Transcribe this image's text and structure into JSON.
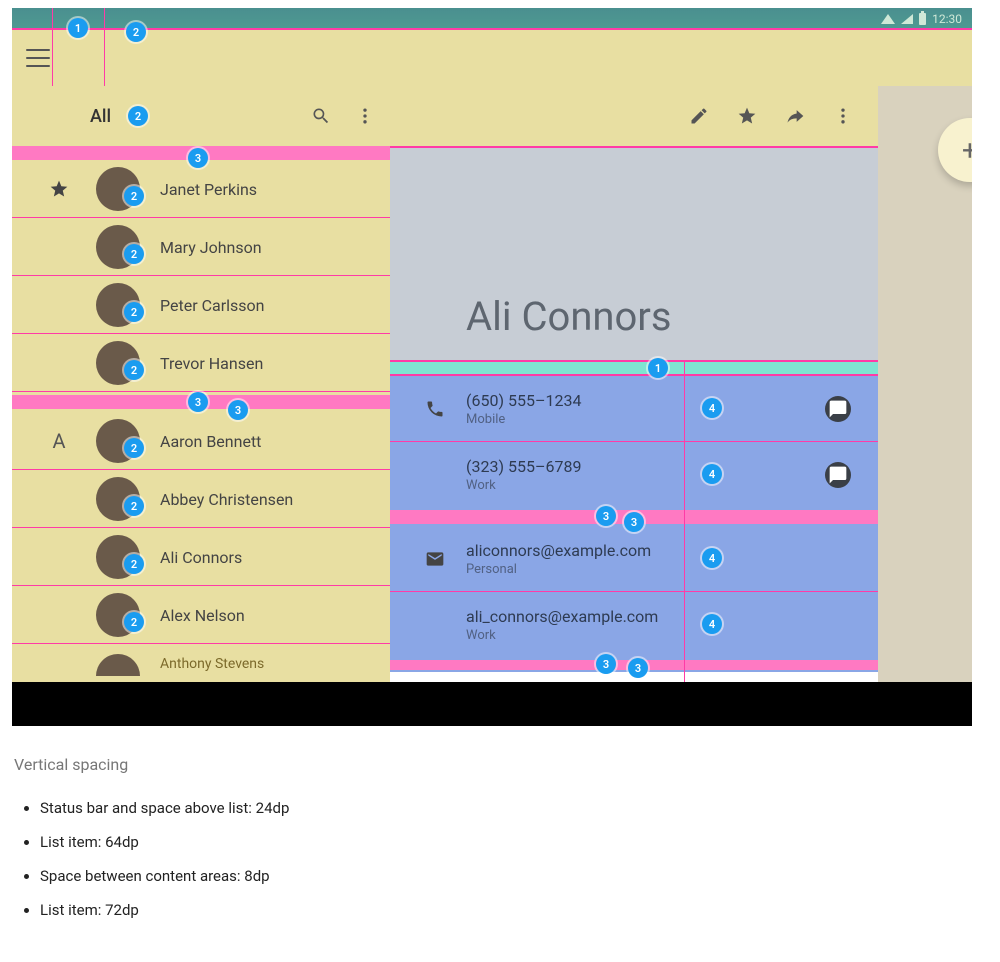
{
  "statusbar": {
    "time": "12:30"
  },
  "left": {
    "filter_label": "All",
    "sections": [
      {
        "marker": "star",
        "items": [
          "Janet Perkins",
          "Mary Johnson",
          "Peter Carlsson",
          "Trevor Hansen"
        ]
      },
      {
        "marker": "A",
        "items": [
          "Aaron Bennett",
          "Abbey Christensen",
          "Ali Connors",
          "Alex Nelson",
          "Anthony Stevens"
        ]
      }
    ]
  },
  "detail": {
    "name": "Ali Connors",
    "phones": [
      {
        "value": "(650) 555–1234",
        "label": "Mobile",
        "sms": true
      },
      {
        "value": "(323) 555–6789",
        "label": "Work",
        "sms": true
      }
    ],
    "emails": [
      {
        "value": "aliconnors@example.com",
        "label": "Personal"
      },
      {
        "value": "ali_connors@example.com",
        "label": "Work"
      }
    ]
  },
  "badges": {
    "b1": "1",
    "b2": "2",
    "b3": "3",
    "b4": "4"
  },
  "caption": {
    "title": "Vertical spacing",
    "items": [
      "Status bar and space above list: 24dp",
      "List item: 64dp",
      "Space between content areas: 8dp",
      "List item: 72dp"
    ]
  }
}
